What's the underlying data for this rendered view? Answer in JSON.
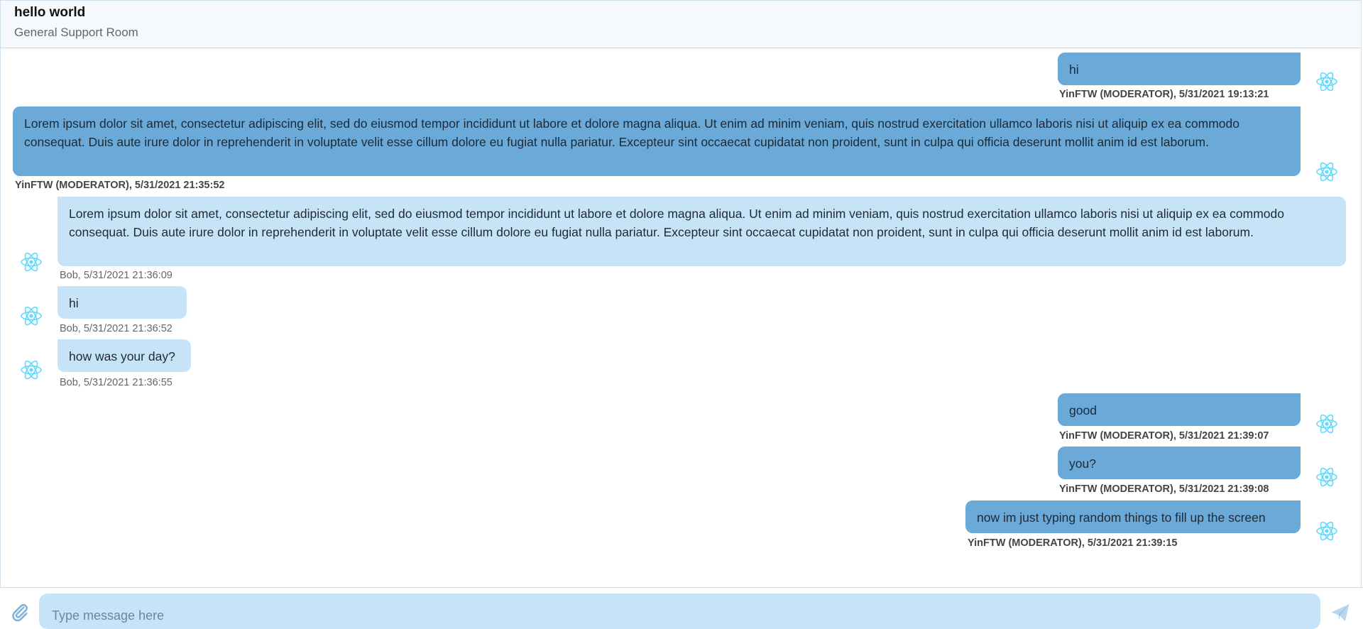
{
  "room": {
    "title": "hello world",
    "subtitle": "General Support Room"
  },
  "messages": [
    {
      "author": "YinFTW (MODERATOR)",
      "text": "hi",
      "meta": "YinFTW (MODERATOR), 5/31/2021 19:13:21",
      "own": true
    },
    {
      "author": "YinFTW (MODERATOR)",
      "text": "Lorem ipsum dolor sit amet, consectetur adipiscing elit, sed do eiusmod tempor incididunt ut labore et dolore magna aliqua. Ut enim ad minim veniam, quis nostrud exercitation ullamco laboris nisi ut aliquip ex ea commodo consequat. Duis aute irure dolor in reprehenderit in voluptate velit esse cillum dolore eu fugiat nulla pariatur. Excepteur sint occaecat cupidatat non proident, sunt in culpa qui officia deserunt mollit anim id est laborum.",
      "meta": "YinFTW (MODERATOR), 5/31/2021 21:35:52",
      "own": true
    },
    {
      "author": "Bob",
      "text": "Lorem ipsum dolor sit amet, consectetur adipiscing elit, sed do eiusmod tempor incididunt ut labore et dolore magna aliqua. Ut enim ad minim veniam, quis nostrud exercitation ullamco laboris nisi ut aliquip ex ea commodo consequat. Duis aute irure dolor in reprehenderit in voluptate velit esse cillum dolore eu fugiat nulla pariatur. Excepteur sint occaecat cupidatat non proident, sunt in culpa qui officia deserunt mollit anim id est laborum.",
      "meta": "Bob, 5/31/2021 21:36:09",
      "own": false
    },
    {
      "author": "Bob",
      "text": "hi",
      "meta": "Bob, 5/31/2021 21:36:52",
      "own": false
    },
    {
      "author": "Bob",
      "text": "how was your day?",
      "meta": "Bob, 5/31/2021 21:36:55",
      "own": false
    },
    {
      "author": "YinFTW (MODERATOR)",
      "text": "good",
      "meta": "YinFTW (MODERATOR), 5/31/2021 21:39:07",
      "own": true
    },
    {
      "author": "YinFTW (MODERATOR)",
      "text": "you?",
      "meta": "YinFTW (MODERATOR), 5/31/2021 21:39:08",
      "own": true
    },
    {
      "author": "YinFTW (MODERATOR)",
      "text": "now im just typing random things to fill up the screen",
      "meta": "YinFTW (MODERATOR), 5/31/2021 21:39:15",
      "own": true
    }
  ],
  "composer": {
    "placeholder": "Type message here",
    "value": ""
  },
  "icons": {
    "avatar": "react-atom-icon",
    "attach": "paperclip-icon",
    "send": "paper-plane-icon"
  },
  "colors": {
    "own_bubble": "#6aa9d8",
    "other_bubble": "#c7e3f8",
    "avatar": "#61dafb",
    "input_bg": "#c7e3f8",
    "icon_blue": "#7fb3d8"
  }
}
